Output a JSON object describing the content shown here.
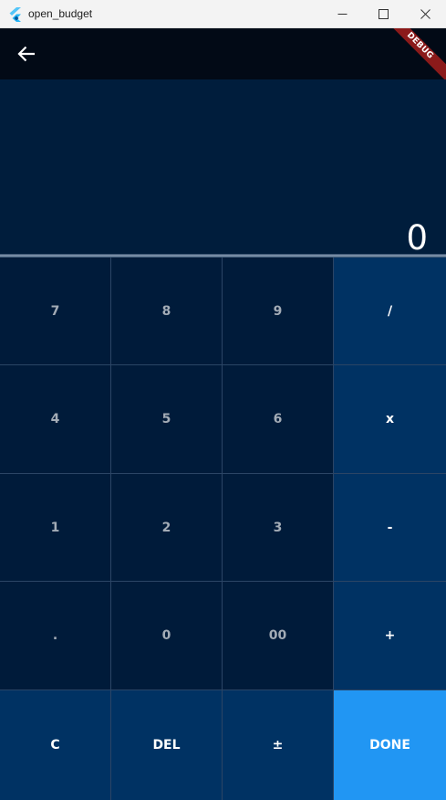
{
  "window": {
    "title": "open_budget"
  },
  "appbar": {
    "back_icon": "arrow-back-icon",
    "debug_label": "DEBUG"
  },
  "display": {
    "value": "0"
  },
  "keypad": {
    "rows": [
      [
        "7",
        "8",
        "9",
        "/"
      ],
      [
        "4",
        "5",
        "6",
        "x"
      ],
      [
        "1",
        "2",
        "3",
        "-"
      ],
      [
        ".",
        "0",
        "00",
        "+"
      ],
      [
        "C",
        "DEL",
        "±",
        "DONE"
      ]
    ]
  },
  "colors": {
    "app_background": "#001b3a",
    "appbar": "#020a16",
    "operator_key": "#003263",
    "done_key": "#2196f3",
    "grid_line": "#2b4565"
  }
}
